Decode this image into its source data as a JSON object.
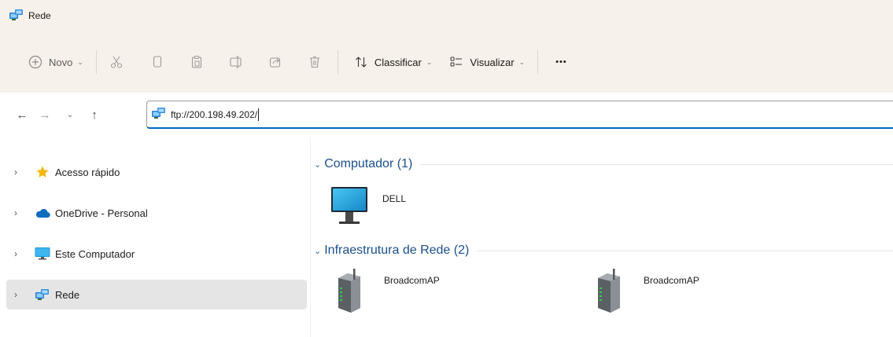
{
  "window": {
    "title": "Rede"
  },
  "toolbar": {
    "new_label": "Novo",
    "sort_label": "Classificar",
    "view_label": "Visualizar",
    "more_label": "•••"
  },
  "address": {
    "path": "ftp://200.198.49.202/"
  },
  "sidebar": {
    "items": [
      {
        "label": "Acesso rápido",
        "icon": "star-icon"
      },
      {
        "label": "OneDrive - Personal",
        "icon": "cloud-icon"
      },
      {
        "label": "Este Computador",
        "icon": "monitor-icon"
      },
      {
        "label": "Rede",
        "icon": "network-icon",
        "selected": true
      }
    ]
  },
  "groups": [
    {
      "label": "Computador (1)",
      "items": [
        {
          "label": "DELL",
          "icon": "computer-icon"
        }
      ]
    },
    {
      "label": "Infraestrutura de Rede (2)",
      "items": [
        {
          "label": "BroadcomAP",
          "icon": "router-icon"
        },
        {
          "label": "BroadcomAP",
          "icon": "router-icon"
        }
      ]
    }
  ],
  "colors": {
    "accent": "#0067c0",
    "chrome": "#f6f1ea",
    "selection": "#e5e5e5",
    "group_header": "#1b4f8a"
  }
}
